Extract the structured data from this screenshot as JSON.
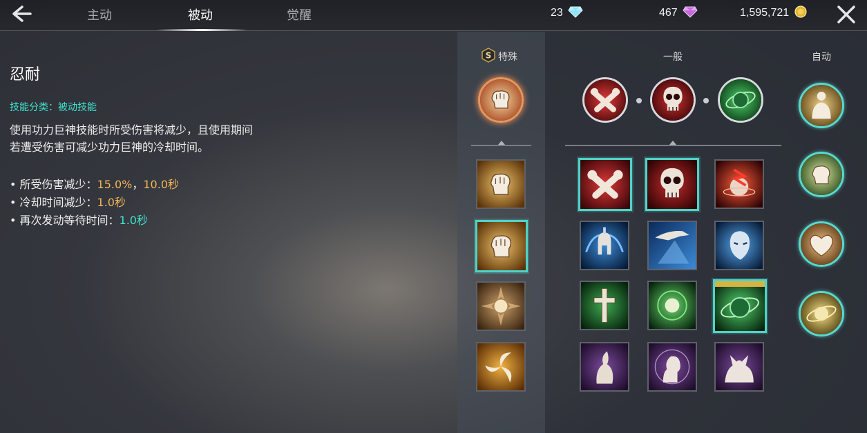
{
  "header": {
    "tabs": [
      {
        "label": "主动"
      },
      {
        "label": "被动"
      },
      {
        "label": "觉醒"
      }
    ],
    "active_tab": "被动",
    "currencies": [
      {
        "value": "23",
        "icon": "diamond-icon",
        "color": "#7ad6f0"
      },
      {
        "value": "467",
        "icon": "purple-gem-icon",
        "color": "#c86bd9"
      },
      {
        "value": "1,595,721",
        "icon": "gold-coin-icon",
        "color": "#e8b93a"
      }
    ]
  },
  "skill": {
    "title": "忍耐",
    "category": "技能分类：被动技能",
    "description": "使用功力巨神技能时所受伤害将减少，且使用期间若遭受伤害可减少功力巨神的冷却时间。",
    "stats": [
      {
        "prefix": "• 所受伤害减少：",
        "value1": "15.0%",
        "sep": "，",
        "value2": "10.0秒"
      },
      {
        "prefix": "• 冷却时间减少：",
        "value1": "1.0秒"
      },
      {
        "prefix": "• 再次发动等待时间：",
        "value1": "1.0秒"
      }
    ]
  },
  "columns": {
    "special": {
      "badge": "S",
      "label": "特殊"
    },
    "general": {
      "label": "一般"
    },
    "auto": {
      "label": "自动"
    }
  },
  "icons": {
    "special_equipped": "fist-skill-icon",
    "special_list": [
      "fist-skill-icon",
      "fist-skill-icon",
      "golden-orb-skill-icon",
      "spiral-blades-skill-icon"
    ],
    "general_equipped": [
      "crossed-arms-skill-icon",
      "skull-skill-icon",
      "green-orb-skill-icon"
    ],
    "general_grid": [
      [
        "crossed-arms-skill-icon",
        "skull-skill-icon",
        "red-burst-skill-icon"
      ],
      [
        "spartan-helmet-skill-icon",
        "blue-hand-skill-icon",
        "blue-face-skill-icon"
      ],
      [
        "cross-skill-icon",
        "green-light-skill-icon",
        "green-orb-skill-icon"
      ],
      [
        "purple-wing-skill-icon",
        "purple-brain-skill-icon",
        "purple-beast-skill-icon"
      ]
    ],
    "auto_list": [
      "body-aura-skill-icon",
      "fist-aura-skill-icon",
      "heart-aura-skill-icon",
      "orb-aura-skill-icon"
    ]
  }
}
